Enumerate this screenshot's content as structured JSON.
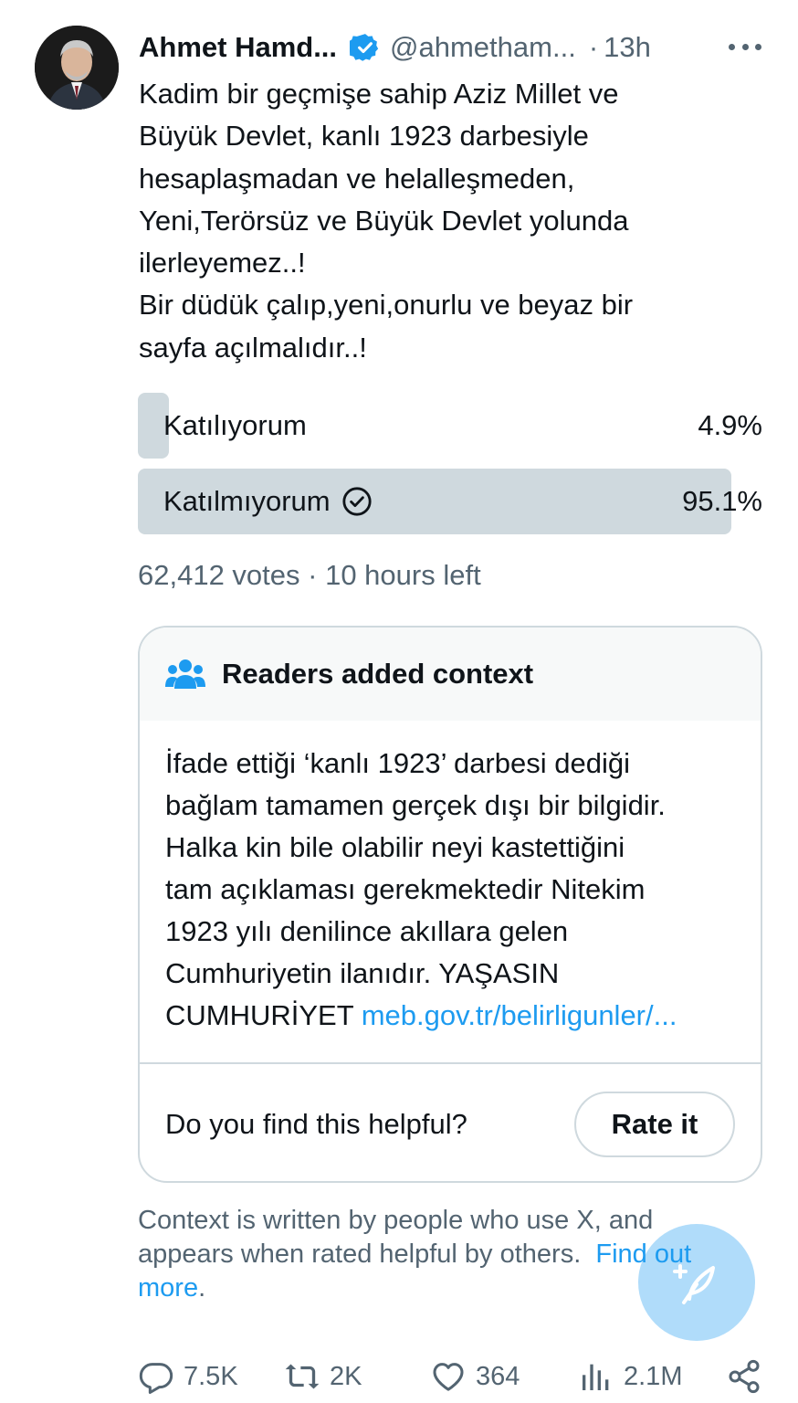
{
  "tweet": {
    "display_name": "Ahmet Hamd...",
    "handle": "@ahmetham...",
    "separator": "·",
    "time": "13h",
    "text_lines": [
      "Kadim bir geçmişe sahip Aziz Millet  ve",
      "Büyük Devlet, kanlı 1923 darbesiyle",
      "hesaplaşmadan ve helalleşmeden,",
      "Yeni,Terörsüz ve Büyük Devlet yolunda",
      "ilerleyemez..!",
      "Bir düdük çalıp,yeni,onurlu ve beyaz bir",
      "sayfa açılmalıdır..!"
    ]
  },
  "poll": {
    "options": [
      {
        "label": "Katılıyorum",
        "percent_label": "4.9%",
        "percent": 4.9,
        "selected": false
      },
      {
        "label": "Katılmıyorum",
        "percent_label": "95.1%",
        "percent": 95.1,
        "selected": true
      }
    ],
    "meta": "62,412 votes · 10 hours left"
  },
  "note": {
    "title": "Readers added context",
    "body_lines": [
      "İfade ettiği ‘kanlı 1923’ darbesi dediği",
      "bağlam tamamen gerçek dışı bir bilgidir.",
      "Halka kin bile olabilir neyi kastettiğini",
      "tam açıklaması gerekmektedir   Nitekim",
      "1923 yılı denilince akıllara gelen",
      "Cumhuriyetin ilanıdır.  YAŞASIN"
    ],
    "last_line_text": "CUMHURİYET ",
    "link_text": "meb.gov.tr/belirligunler/...",
    "helpful_question": "Do you find this helpful?",
    "rate_button": "Rate it"
  },
  "context_footer": {
    "line1": "Context is written by people who use X, and",
    "line2_text": "appears when rated helpful by others.  ",
    "line2_link": "Find out",
    "line3_link": "more",
    "line3_tail": "."
  },
  "actions": {
    "replies": "7.5K",
    "reposts": "2K",
    "likes": "364",
    "views": "2.1M"
  },
  "colors": {
    "accent": "#1d9bf0",
    "secondary_text": "#536471",
    "poll_bar": "#cfd9de",
    "border": "#cfd9de"
  }
}
